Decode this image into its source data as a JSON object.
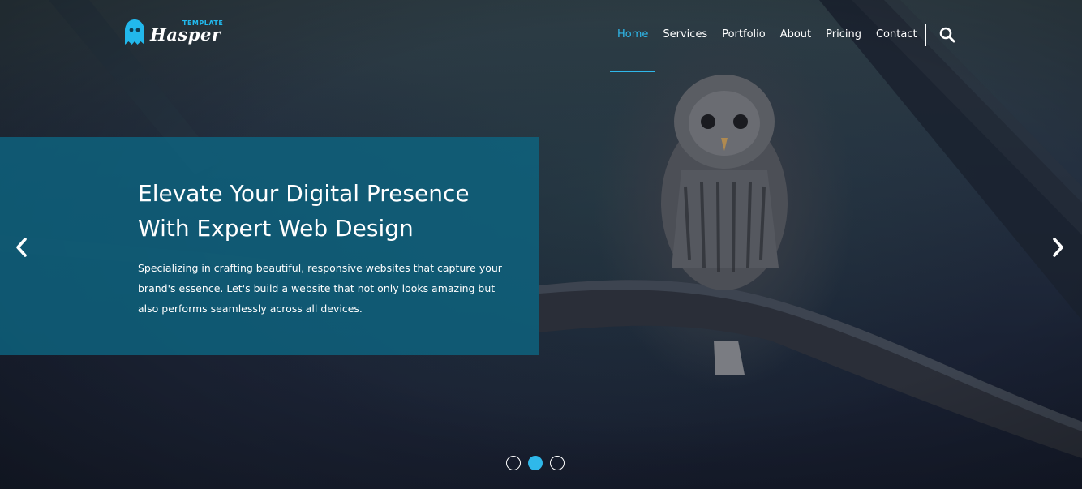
{
  "brand": {
    "name": "Hasper",
    "tag": "TEMPLATE",
    "icon": "ghost-icon",
    "accent_color": "#2fb8ea"
  },
  "nav": {
    "items": [
      {
        "label": "Home",
        "active": true
      },
      {
        "label": "Services",
        "active": false
      },
      {
        "label": "Portfolio",
        "active": false
      },
      {
        "label": "About",
        "active": false
      },
      {
        "label": "Pricing",
        "active": false
      },
      {
        "label": "Contact",
        "active": false
      }
    ],
    "search_icon": "search-icon"
  },
  "slide": {
    "title_line1": "Elevate Your Digital Presence",
    "title_line2": "With Expert Web Design",
    "text": "Specializing in crafting beautiful, responsive websites that capture your brand's essence. Let's build a website that not only looks amazing but also performs seamlessly across all devices.",
    "panel_color": "#0e6480",
    "prev_icon": "chevron-left-icon",
    "next_icon": "chevron-right-icon"
  },
  "carousel": {
    "slide_count": 3,
    "active_index": 1
  }
}
